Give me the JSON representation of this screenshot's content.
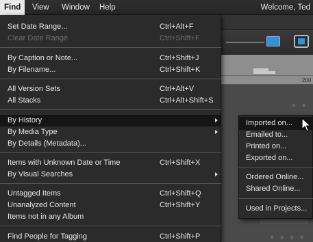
{
  "menubar": {
    "items": [
      {
        "label": "Find"
      },
      {
        "label": "View"
      },
      {
        "label": "Window"
      },
      {
        "label": "Help"
      }
    ],
    "welcome": "Welcome, Ted"
  },
  "background": {
    "timeline_year": "200"
  },
  "find_menu": {
    "items": [
      {
        "label": "Set Date Range...",
        "shortcut": "Ctrl+Alt+F"
      },
      {
        "label": "Clear Date Range",
        "shortcut": "Ctrl+Shift+F"
      },
      {
        "label": "By Caption or Note...",
        "shortcut": "Ctrl+Shift+J"
      },
      {
        "label": "By Filename...",
        "shortcut": "Ctrl+Shift+K"
      },
      {
        "label": "All Version Sets",
        "shortcut": "Ctrl+Alt+V"
      },
      {
        "label": "All Stacks",
        "shortcut": "Ctrl+Alt+Shift+S"
      },
      {
        "label": "By History",
        "shortcut": ""
      },
      {
        "label": "By Media Type",
        "shortcut": ""
      },
      {
        "label": "By Details (Metadata)...",
        "shortcut": ""
      },
      {
        "label": "Items with Unknown Date or Time",
        "shortcut": "Ctrl+Shift+X"
      },
      {
        "label": "By Visual Searches",
        "shortcut": ""
      },
      {
        "label": "Untagged Items",
        "shortcut": "Ctrl+Shift+Q"
      },
      {
        "label": "Unanalyzed Content",
        "shortcut": "Ctrl+Shift+Y"
      },
      {
        "label": "Items not in any Album",
        "shortcut": ""
      },
      {
        "label": "Find People for Tagging",
        "shortcut": "Ctrl+Shift+P"
      }
    ]
  },
  "history_submenu": {
    "items": [
      {
        "label": "Imported on..."
      },
      {
        "label": "Emailed to..."
      },
      {
        "label": "Printed on..."
      },
      {
        "label": "Exported on..."
      },
      {
        "label": "Ordered Online..."
      },
      {
        "label": "Shared Online..."
      },
      {
        "label": "Used in Projects..."
      }
    ]
  }
}
